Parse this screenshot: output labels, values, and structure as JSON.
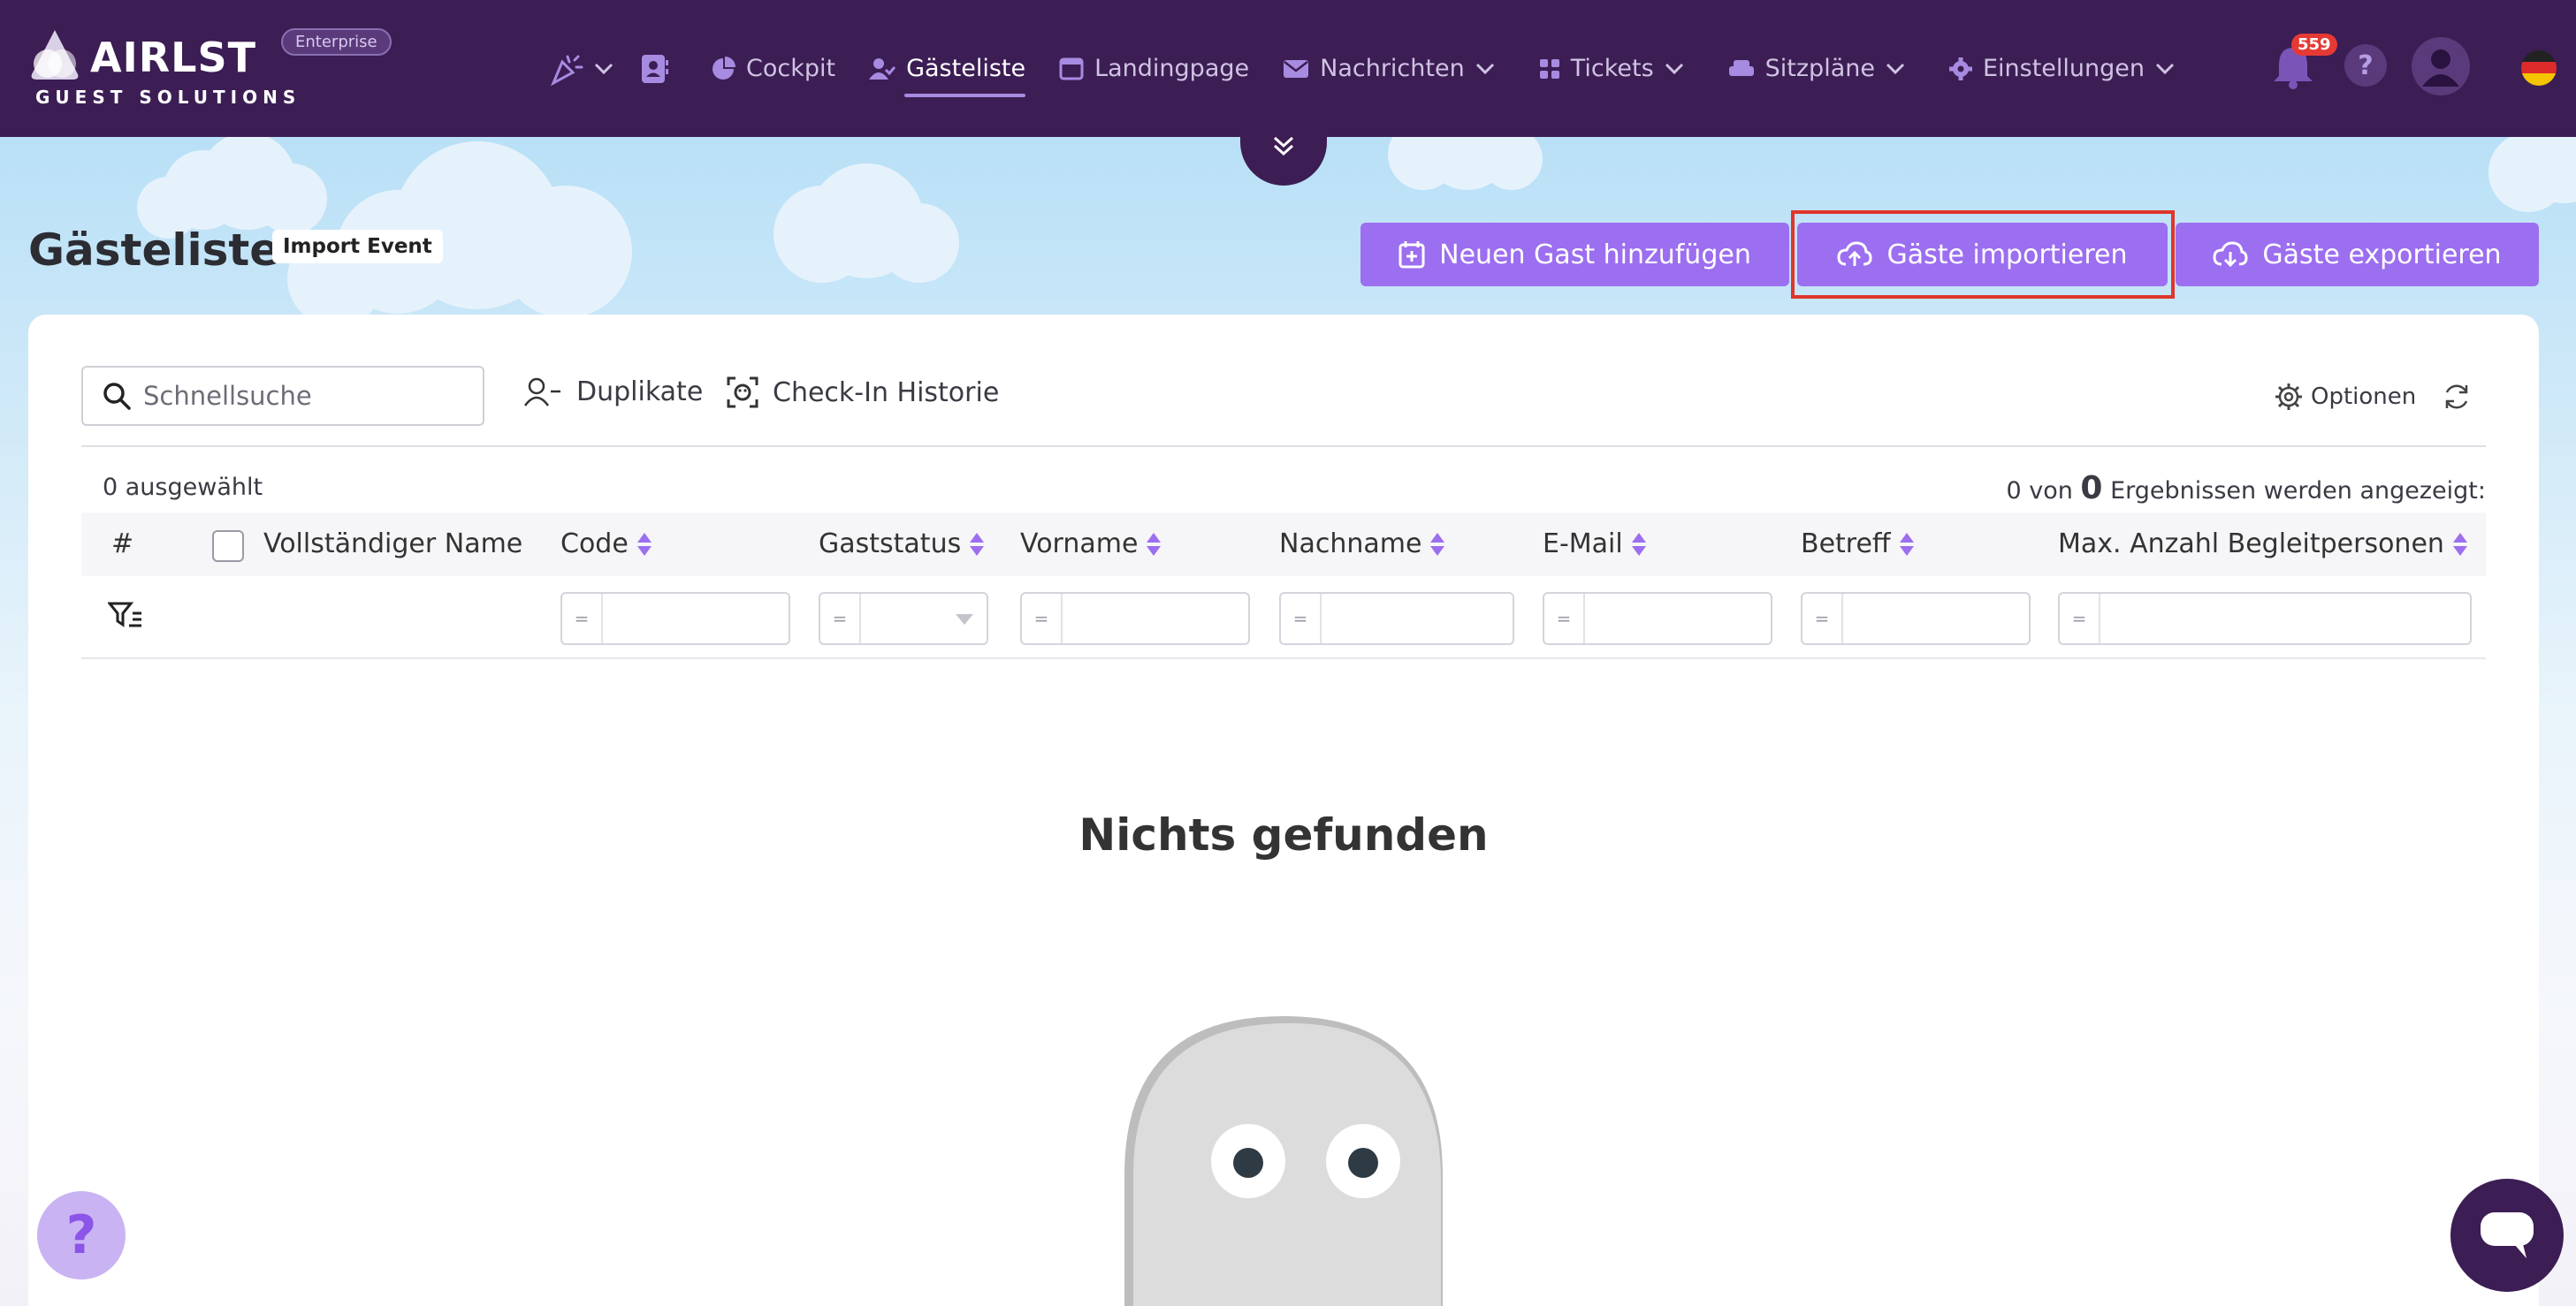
{
  "brand": {
    "name": "AIRLST",
    "subtitle": "GUEST SOLUTIONS",
    "plan_badge": "Enterprise"
  },
  "nav": {
    "items": [
      {
        "label": "Cockpit",
        "icon": "pie-chart-icon"
      },
      {
        "label": "Gästeliste",
        "icon": "user-check-icon",
        "active": true
      },
      {
        "label": "Landingpage",
        "icon": "browser-window-icon"
      },
      {
        "label": "Nachrichten",
        "icon": "envelope-icon",
        "dropdown": true
      },
      {
        "label": "Tickets",
        "icon": "grid-icon",
        "dropdown": true
      },
      {
        "label": "Sitzpläne",
        "icon": "armchair-icon",
        "dropdown": true
      },
      {
        "label": "Einstellungen",
        "icon": "gear-icon",
        "dropdown": true
      }
    ],
    "notification_count": "559",
    "help_label": "?",
    "language": "de"
  },
  "page": {
    "title": "Gästeliste",
    "event_badge": "Import Event",
    "actions": {
      "add_guest": "Neuen Gast hinzufügen",
      "import_guests": "Gäste importieren",
      "export_guests": "Gäste exportieren"
    }
  },
  "toolbar": {
    "search_placeholder": "Schnellsuche",
    "duplicates": "Duplikate",
    "checkin_history": "Check-In Historie",
    "options": "Optionen"
  },
  "table": {
    "selected_text": "0 ausgewählt",
    "results_prefix": "0 von",
    "results_total": "0",
    "results_suffix": "Ergebnissen werden angezeigt:",
    "columns": {
      "index": "#",
      "full_name": "Vollständiger Name",
      "code": "Code",
      "status": "Gaststatus",
      "first_name": "Vorname",
      "last_name": "Nachname",
      "email": "E-Mail",
      "subject": "Betreff",
      "max_companions": "Max. Anzahl Begleitpersonen"
    },
    "filter_operator": "="
  },
  "empty_state": {
    "title": "Nichts gefunden"
  },
  "colors": {
    "nav_bg": "#3c1d54",
    "accent": "#9c6ef0",
    "highlight": "#e0352b"
  }
}
